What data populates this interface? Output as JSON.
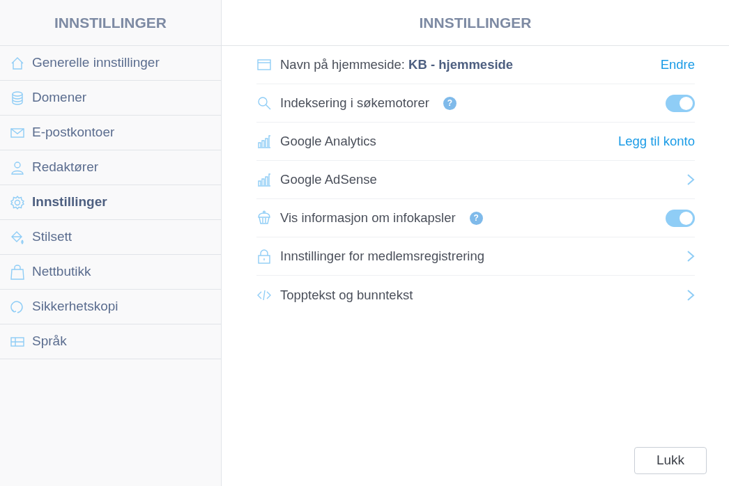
{
  "sidebar": {
    "title": "INNSTILLINGER",
    "items": [
      {
        "label": "Generelle innstillinger",
        "selected": false
      },
      {
        "label": "Domener",
        "selected": false
      },
      {
        "label": "E-postkontoer",
        "selected": false
      },
      {
        "label": "Redaktører",
        "selected": false
      },
      {
        "label": "Innstillinger",
        "selected": true
      },
      {
        "label": "Stilsett",
        "selected": false
      },
      {
        "label": "Nettbutikk",
        "selected": false
      },
      {
        "label": "Sikkerhetskopi",
        "selected": false
      },
      {
        "label": "Språk",
        "selected": false
      }
    ]
  },
  "main": {
    "title": "INNSTILLINGER",
    "rows": [
      {
        "kind": "link",
        "label": "Navn på hjemmeside: **KB - hjemmeside**",
        "action": "Endre"
      },
      {
        "kind": "toggle",
        "label": "Indeksering i søkemotorer",
        "help": "?",
        "on": true
      },
      {
        "kind": "link",
        "label": "Google Analytics",
        "action": "Legg til konto"
      },
      {
        "kind": "chevron",
        "label": "Google AdSense"
      },
      {
        "kind": "toggle",
        "label": "Vis informasjon om infokapsler",
        "help": "?",
        "on": true
      },
      {
        "kind": "chevron",
        "label": "Innstillinger for medlemsregistrering"
      },
      {
        "kind": "chevron",
        "label": "Topptekst og bunntekst"
      }
    ],
    "close_button": "Lukk"
  }
}
